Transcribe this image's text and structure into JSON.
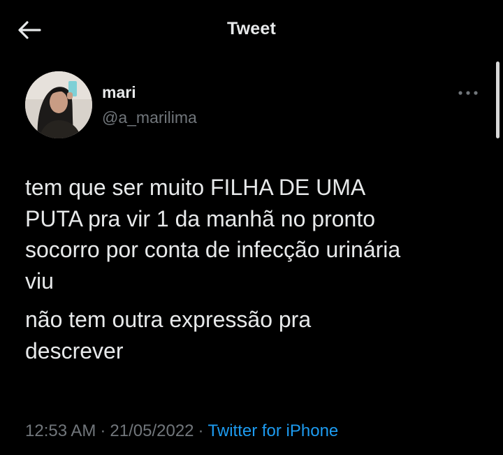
{
  "header": {
    "title": "Tweet",
    "back_icon": "arrow-left-icon"
  },
  "author": {
    "name": "mari",
    "handle": "@a_marilima",
    "avatar_icon": "avatar"
  },
  "more_icon": "more-horizontal-icon",
  "tweet": {
    "paragraph_1_line_1": "tem que ser muito FILHA DE UMA",
    "paragraph_1_line_2": "PUTA pra vir 1 da manhã no pronto",
    "paragraph_1_line_3": "socorro por conta de infecção urinária",
    "paragraph_1_line_4": "viu",
    "paragraph_2_line_1": "não tem outra expressão pra",
    "paragraph_2_line_2": "descrever"
  },
  "meta": {
    "time": "12:53 AM",
    "separator": "·",
    "date": "21/05/2022",
    "source": "Twitter for iPhone"
  },
  "colors": {
    "background": "#000000",
    "text": "#e7e9ea",
    "secondary_text": "#71767b",
    "link": "#1d9bf0"
  }
}
